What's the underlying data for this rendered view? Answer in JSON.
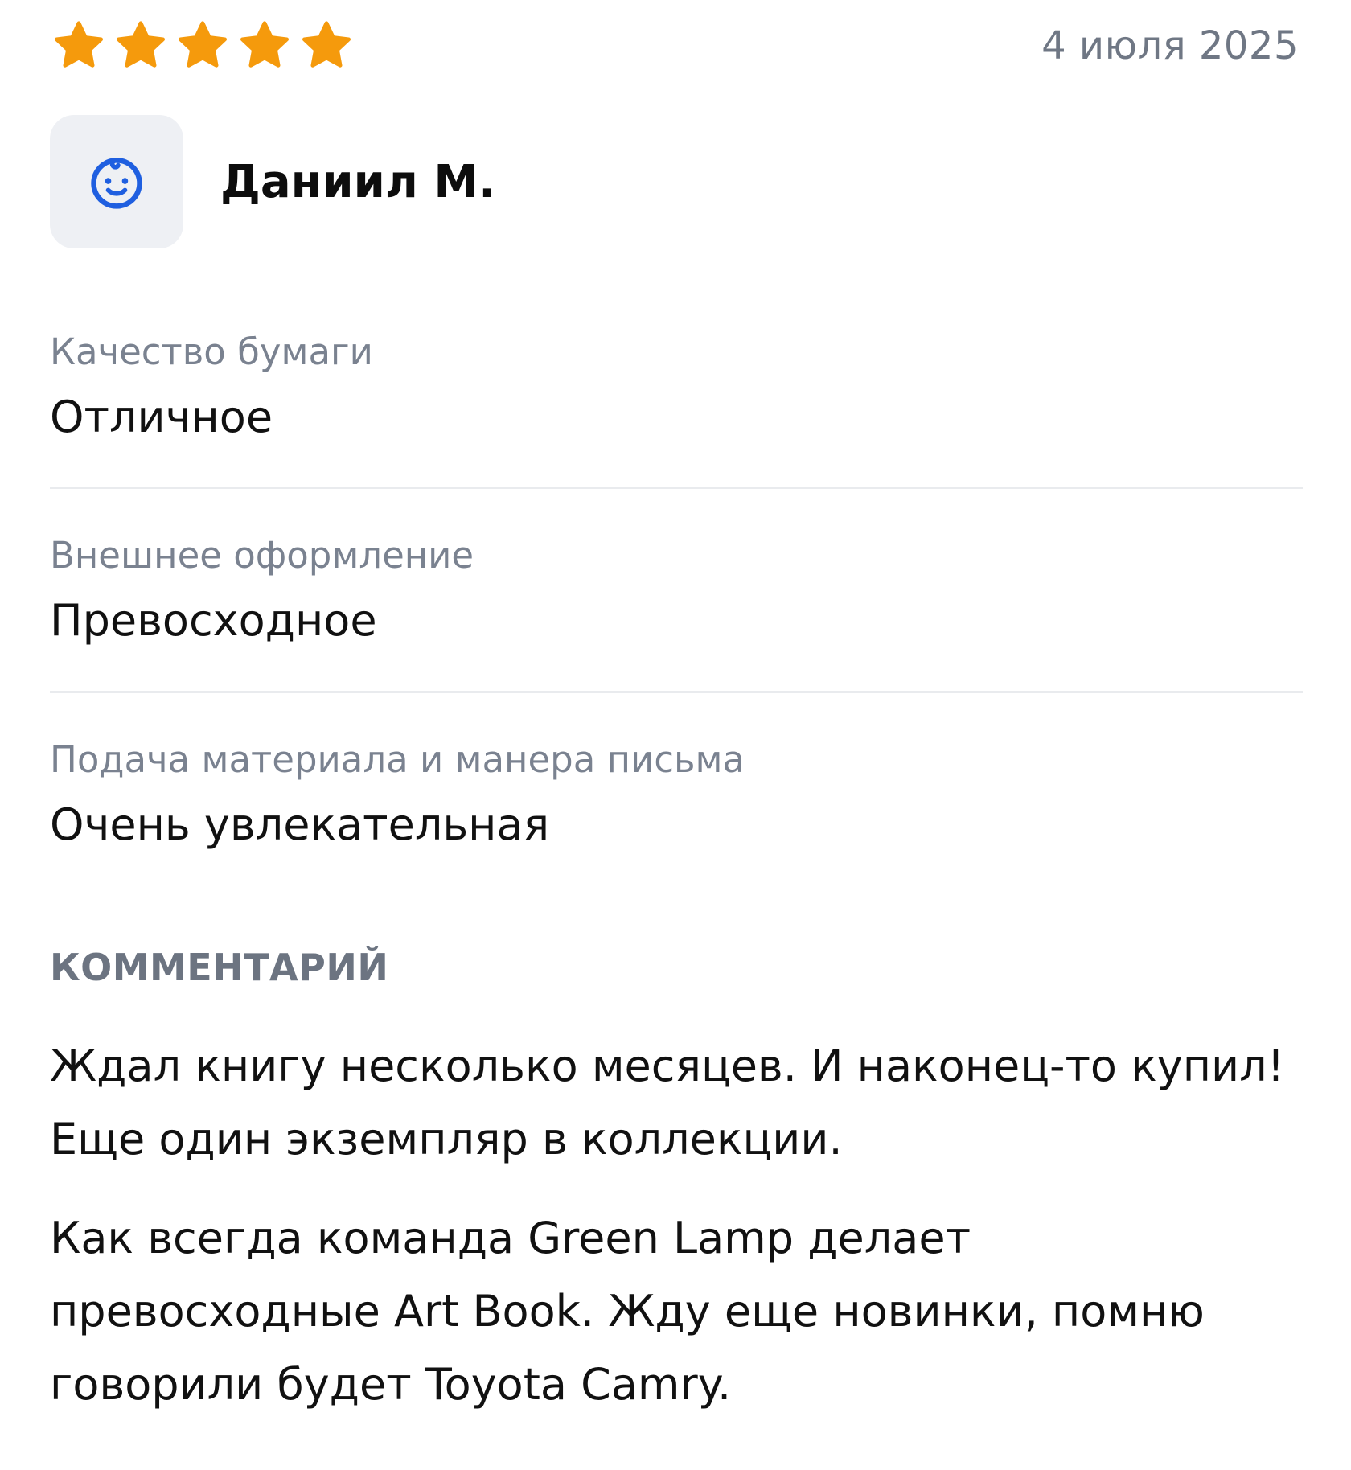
{
  "review": {
    "rating": 5,
    "rating_max": 5,
    "date": "4 июля 2025",
    "author": {
      "name": "Даниил М.",
      "avatar_icon": "smiley-face-icon"
    },
    "attributes": [
      {
        "label": "Качество бумаги",
        "value": "Отличное"
      },
      {
        "label": "Внешнее оформление",
        "value": "Превосходное"
      },
      {
        "label": "Подача материала и манера письма",
        "value": "Очень увлекательная"
      }
    ],
    "comment_heading": "КОММЕНТАРИЙ",
    "comment_paragraphs": [
      "Ждал книгу несколько месяцев. И наконец-то купил! Еще один экземпляр в коллекции.",
      "Как всегда команда Green Lamp делает превосходные Art Book. Жду еще новинки, помню говорили будет Toyota Camry."
    ]
  },
  "colors": {
    "star": "#f59a0c",
    "avatar_bg": "#eef0f4",
    "avatar_icon": "#1f5fe0",
    "muted_text": "#7a8290",
    "divider": "#e9ebee"
  }
}
